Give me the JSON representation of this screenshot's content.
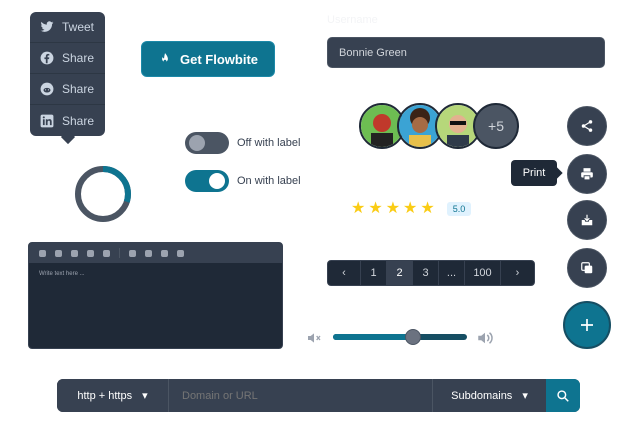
{
  "share_menu": {
    "items": [
      {
        "label": "Tweet",
        "icon": "twitter-icon"
      },
      {
        "label": "Share",
        "icon": "facebook-icon"
      },
      {
        "label": "Share",
        "icon": "reddit-icon"
      },
      {
        "label": "Share",
        "icon": "linkedin-icon"
      }
    ]
  },
  "cta": {
    "label": "Get Flowbite",
    "icon": "flame-icon"
  },
  "progress": {
    "value": 0.3
  },
  "toggles": {
    "off_label": "Off with label",
    "on_label": "On with label"
  },
  "editor": {
    "placeholder": "Write text here ..."
  },
  "name_field": {
    "label": "Username",
    "value": "Bonnie Green"
  },
  "avatars": {
    "more_label": "+5"
  },
  "rating": {
    "stars": 5,
    "value": "5.0"
  },
  "pagination": {
    "pages": [
      "1",
      "2",
      "3",
      "...",
      "100"
    ],
    "active": "2"
  },
  "volume": {
    "level": 0.6
  },
  "speed_dial": {
    "tooltip": "Print"
  },
  "url_bar": {
    "protocol": "http + https",
    "placeholder": "Domain or URL",
    "subdomains": "Subdomains"
  },
  "colors": {
    "accent": "#0e7490",
    "dark": "#1f2937",
    "surface": "#374151",
    "star": "#facc15"
  }
}
